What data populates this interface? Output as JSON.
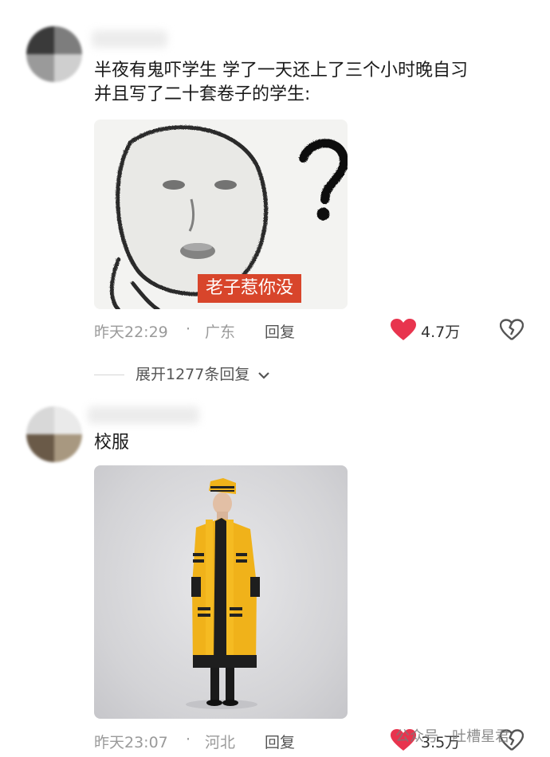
{
  "comments": [
    {
      "text_line1": "半夜有鬼吓学生 学了一天还上了三个小时晚自习",
      "text_line2": "并且写了二十套卷子的学生:",
      "meme_caption": "老子惹你没",
      "time": "昨天22:29",
      "separator": "·",
      "location": "广东",
      "reply_label": "回复",
      "likes": "4.7万"
    },
    {
      "text": "校服",
      "time": "昨天23:07",
      "separator": "·",
      "location": "河北",
      "reply_label": "回复",
      "likes": "3.5万"
    }
  ],
  "expand_replies": "展开1277条回复",
  "watermark": "公众号 · 吐槽星君",
  "colors": {
    "like_red": "#e8344e",
    "caption_bg": "#d8452b",
    "robe_yellow": "#f0b21a"
  }
}
